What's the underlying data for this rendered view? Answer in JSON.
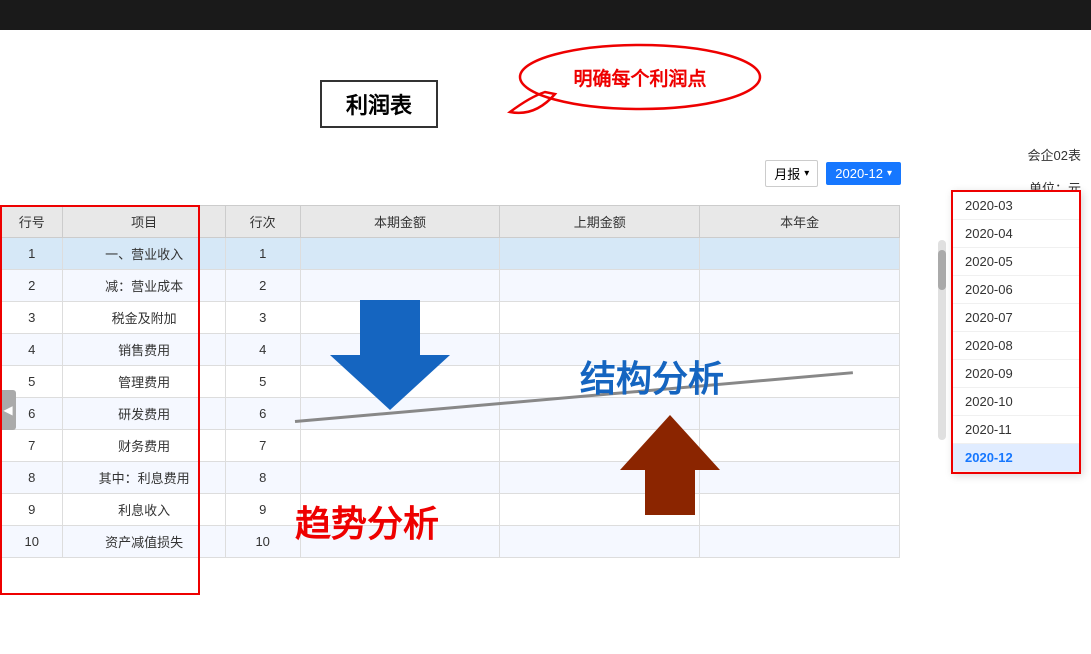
{
  "app": {
    "title": "利润表",
    "company": "会企02表",
    "unit": "单位：元",
    "callout_text": "明确每个利润点",
    "jiegou_text": "结构分析",
    "qushi_text": "趋势分析"
  },
  "period_selector": {
    "type_label": "月报",
    "selected_value": "2020-12",
    "dropdown_items": [
      "2020-03",
      "2020-04",
      "2020-05",
      "2020-06",
      "2020-07",
      "2020-08",
      "2020-09",
      "2020-10",
      "2020-11",
      "2020-12"
    ]
  },
  "table": {
    "headers": [
      "行号",
      "项目",
      "行次",
      "本期金额",
      "上期金额",
      "本年金"
    ],
    "rows": [
      {
        "hang": "1",
        "xiangmu": "一、营业收入",
        "hangci": "1",
        "bq": "",
        "sq": "",
        "bn": ""
      },
      {
        "hang": "2",
        "xiangmu": "减：营业成本",
        "hangci": "2",
        "bq": "",
        "sq": "",
        "bn": ""
      },
      {
        "hang": "3",
        "xiangmu": "税金及附加",
        "hangci": "3",
        "bq": "",
        "sq": "",
        "bn": ""
      },
      {
        "hang": "4",
        "xiangmu": "销售费用",
        "hangci": "4",
        "bq": "",
        "sq": "",
        "bn": ""
      },
      {
        "hang": "5",
        "xiangmu": "管理费用",
        "hangci": "5",
        "bq": "",
        "sq": "",
        "bn": ""
      },
      {
        "hang": "6",
        "xiangmu": "研发费用",
        "hangci": "6",
        "bq": "",
        "sq": "",
        "bn": ""
      },
      {
        "hang": "7",
        "xiangmu": "财务费用",
        "hangci": "7",
        "bq": "",
        "sq": "",
        "bn": ""
      },
      {
        "hang": "8",
        "xiangmu": "其中：利息费用",
        "hangci": "8",
        "bq": "",
        "sq": "",
        "bn": ""
      },
      {
        "hang": "9",
        "xiangmu": "利息收入",
        "hangci": "9",
        "bq": "",
        "sq": "",
        "bn": ""
      },
      {
        "hang": "10",
        "xiangmu": "资产减值损失",
        "hangci": "10",
        "bq": "",
        "sq": "",
        "bn": ""
      }
    ]
  }
}
